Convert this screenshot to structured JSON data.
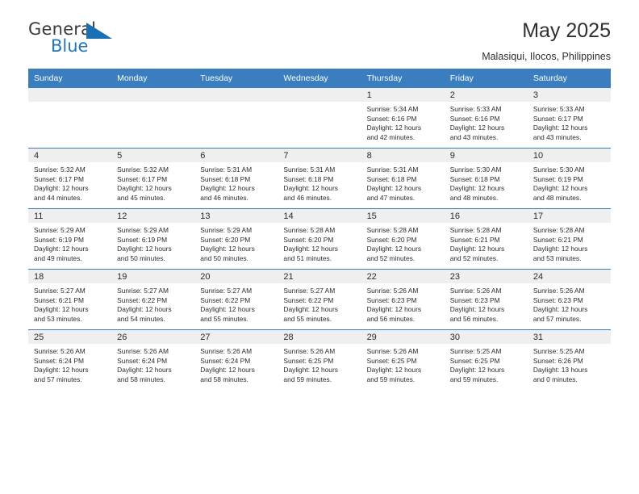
{
  "logo": {
    "word_top": "General",
    "word_bottom": "Blue",
    "triangle_color": "#1a6fb5"
  },
  "header": {
    "title": "May 2025",
    "subtitle": "Malasiqui, Ilocos, Philippines"
  },
  "theme": {
    "header_blue": "#3a7ebf",
    "daynum_band": "#efefef",
    "text": "#2b2b2b"
  },
  "calendar": {
    "weekday_headers": [
      "Sunday",
      "Monday",
      "Tuesday",
      "Wednesday",
      "Thursday",
      "Friday",
      "Saturday"
    ],
    "weeks": [
      [
        {
          "day": "",
          "sunrise": "",
          "sunset": "",
          "daylight1": "",
          "daylight2": ""
        },
        {
          "day": "",
          "sunrise": "",
          "sunset": "",
          "daylight1": "",
          "daylight2": ""
        },
        {
          "day": "",
          "sunrise": "",
          "sunset": "",
          "daylight1": "",
          "daylight2": ""
        },
        {
          "day": "",
          "sunrise": "",
          "sunset": "",
          "daylight1": "",
          "daylight2": ""
        },
        {
          "day": "1",
          "sunrise": "Sunrise: 5:34 AM",
          "sunset": "Sunset: 6:16 PM",
          "daylight1": "Daylight: 12 hours",
          "daylight2": "and 42 minutes."
        },
        {
          "day": "2",
          "sunrise": "Sunrise: 5:33 AM",
          "sunset": "Sunset: 6:16 PM",
          "daylight1": "Daylight: 12 hours",
          "daylight2": "and 43 minutes."
        },
        {
          "day": "3",
          "sunrise": "Sunrise: 5:33 AM",
          "sunset": "Sunset: 6:17 PM",
          "daylight1": "Daylight: 12 hours",
          "daylight2": "and 43 minutes."
        }
      ],
      [
        {
          "day": "4",
          "sunrise": "Sunrise: 5:32 AM",
          "sunset": "Sunset: 6:17 PM",
          "daylight1": "Daylight: 12 hours",
          "daylight2": "and 44 minutes."
        },
        {
          "day": "5",
          "sunrise": "Sunrise: 5:32 AM",
          "sunset": "Sunset: 6:17 PM",
          "daylight1": "Daylight: 12 hours",
          "daylight2": "and 45 minutes."
        },
        {
          "day": "6",
          "sunrise": "Sunrise: 5:31 AM",
          "sunset": "Sunset: 6:18 PM",
          "daylight1": "Daylight: 12 hours",
          "daylight2": "and 46 minutes."
        },
        {
          "day": "7",
          "sunrise": "Sunrise: 5:31 AM",
          "sunset": "Sunset: 6:18 PM",
          "daylight1": "Daylight: 12 hours",
          "daylight2": "and 46 minutes."
        },
        {
          "day": "8",
          "sunrise": "Sunrise: 5:31 AM",
          "sunset": "Sunset: 6:18 PM",
          "daylight1": "Daylight: 12 hours",
          "daylight2": "and 47 minutes."
        },
        {
          "day": "9",
          "sunrise": "Sunrise: 5:30 AM",
          "sunset": "Sunset: 6:18 PM",
          "daylight1": "Daylight: 12 hours",
          "daylight2": "and 48 minutes."
        },
        {
          "day": "10",
          "sunrise": "Sunrise: 5:30 AM",
          "sunset": "Sunset: 6:19 PM",
          "daylight1": "Daylight: 12 hours",
          "daylight2": "and 48 minutes."
        }
      ],
      [
        {
          "day": "11",
          "sunrise": "Sunrise: 5:29 AM",
          "sunset": "Sunset: 6:19 PM",
          "daylight1": "Daylight: 12 hours",
          "daylight2": "and 49 minutes."
        },
        {
          "day": "12",
          "sunrise": "Sunrise: 5:29 AM",
          "sunset": "Sunset: 6:19 PM",
          "daylight1": "Daylight: 12 hours",
          "daylight2": "and 50 minutes."
        },
        {
          "day": "13",
          "sunrise": "Sunrise: 5:29 AM",
          "sunset": "Sunset: 6:20 PM",
          "daylight1": "Daylight: 12 hours",
          "daylight2": "and 50 minutes."
        },
        {
          "day": "14",
          "sunrise": "Sunrise: 5:28 AM",
          "sunset": "Sunset: 6:20 PM",
          "daylight1": "Daylight: 12 hours",
          "daylight2": "and 51 minutes."
        },
        {
          "day": "15",
          "sunrise": "Sunrise: 5:28 AM",
          "sunset": "Sunset: 6:20 PM",
          "daylight1": "Daylight: 12 hours",
          "daylight2": "and 52 minutes."
        },
        {
          "day": "16",
          "sunrise": "Sunrise: 5:28 AM",
          "sunset": "Sunset: 6:21 PM",
          "daylight1": "Daylight: 12 hours",
          "daylight2": "and 52 minutes."
        },
        {
          "day": "17",
          "sunrise": "Sunrise: 5:28 AM",
          "sunset": "Sunset: 6:21 PM",
          "daylight1": "Daylight: 12 hours",
          "daylight2": "and 53 minutes."
        }
      ],
      [
        {
          "day": "18",
          "sunrise": "Sunrise: 5:27 AM",
          "sunset": "Sunset: 6:21 PM",
          "daylight1": "Daylight: 12 hours",
          "daylight2": "and 53 minutes."
        },
        {
          "day": "19",
          "sunrise": "Sunrise: 5:27 AM",
          "sunset": "Sunset: 6:22 PM",
          "daylight1": "Daylight: 12 hours",
          "daylight2": "and 54 minutes."
        },
        {
          "day": "20",
          "sunrise": "Sunrise: 5:27 AM",
          "sunset": "Sunset: 6:22 PM",
          "daylight1": "Daylight: 12 hours",
          "daylight2": "and 55 minutes."
        },
        {
          "day": "21",
          "sunrise": "Sunrise: 5:27 AM",
          "sunset": "Sunset: 6:22 PM",
          "daylight1": "Daylight: 12 hours",
          "daylight2": "and 55 minutes."
        },
        {
          "day": "22",
          "sunrise": "Sunrise: 5:26 AM",
          "sunset": "Sunset: 6:23 PM",
          "daylight1": "Daylight: 12 hours",
          "daylight2": "and 56 minutes."
        },
        {
          "day": "23",
          "sunrise": "Sunrise: 5:26 AM",
          "sunset": "Sunset: 6:23 PM",
          "daylight1": "Daylight: 12 hours",
          "daylight2": "and 56 minutes."
        },
        {
          "day": "24",
          "sunrise": "Sunrise: 5:26 AM",
          "sunset": "Sunset: 6:23 PM",
          "daylight1": "Daylight: 12 hours",
          "daylight2": "and 57 minutes."
        }
      ],
      [
        {
          "day": "25",
          "sunrise": "Sunrise: 5:26 AM",
          "sunset": "Sunset: 6:24 PM",
          "daylight1": "Daylight: 12 hours",
          "daylight2": "and 57 minutes."
        },
        {
          "day": "26",
          "sunrise": "Sunrise: 5:26 AM",
          "sunset": "Sunset: 6:24 PM",
          "daylight1": "Daylight: 12 hours",
          "daylight2": "and 58 minutes."
        },
        {
          "day": "27",
          "sunrise": "Sunrise: 5:26 AM",
          "sunset": "Sunset: 6:24 PM",
          "daylight1": "Daylight: 12 hours",
          "daylight2": "and 58 minutes."
        },
        {
          "day": "28",
          "sunrise": "Sunrise: 5:26 AM",
          "sunset": "Sunset: 6:25 PM",
          "daylight1": "Daylight: 12 hours",
          "daylight2": "and 59 minutes."
        },
        {
          "day": "29",
          "sunrise": "Sunrise: 5:26 AM",
          "sunset": "Sunset: 6:25 PM",
          "daylight1": "Daylight: 12 hours",
          "daylight2": "and 59 minutes."
        },
        {
          "day": "30",
          "sunrise": "Sunrise: 5:25 AM",
          "sunset": "Sunset: 6:25 PM",
          "daylight1": "Daylight: 12 hours",
          "daylight2": "and 59 minutes."
        },
        {
          "day": "31",
          "sunrise": "Sunrise: 5:25 AM",
          "sunset": "Sunset: 6:26 PM",
          "daylight1": "Daylight: 13 hours",
          "daylight2": "and 0 minutes."
        }
      ]
    ]
  }
}
